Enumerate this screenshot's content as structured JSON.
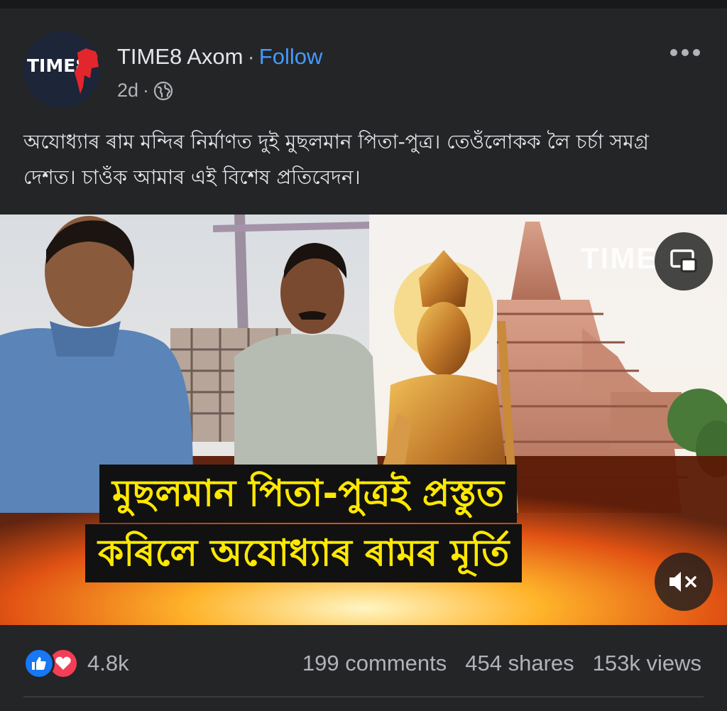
{
  "post": {
    "page_name": "TIME8 Axom",
    "separator": "·",
    "follow_label": "Follow",
    "timestamp": "2d",
    "meta_separator": "·",
    "privacy_icon": "globe-icon",
    "more_icon": "more-options-icon",
    "caption": "অযোধ্যাৰ ৰাম মন্দিৰ নিৰ্মাণত দুই মুছলমান পিতা-পুত্ৰ। তেওঁলোকক লৈ চৰ্চা সমগ্ৰ দেশত। চাওঁক আমাৰ এই বিশেষ প্ৰতিবেদন।"
  },
  "avatar": {
    "logo_text": "TIME8"
  },
  "media": {
    "headline_line1": "মুছলমান পিতা-পুত্ৰই প্ৰস্তুত",
    "headline_line2": "কৰিলে অযোধ্যাৰ ৰামৰ মূৰ্তি",
    "watermark": "TIME8",
    "pip_icon": "picture-in-picture-icon",
    "mute_icon": "muted-speaker-icon"
  },
  "footer": {
    "reaction_count": "4.8k",
    "comments": "199 comments",
    "shares": "454 shares",
    "views": "153k views"
  },
  "colors": {
    "background": "#242527",
    "follow_link": "#4599ff",
    "headline_text": "#ffe800",
    "like_blue": "#1877f2",
    "love_red": "#f33e58"
  }
}
